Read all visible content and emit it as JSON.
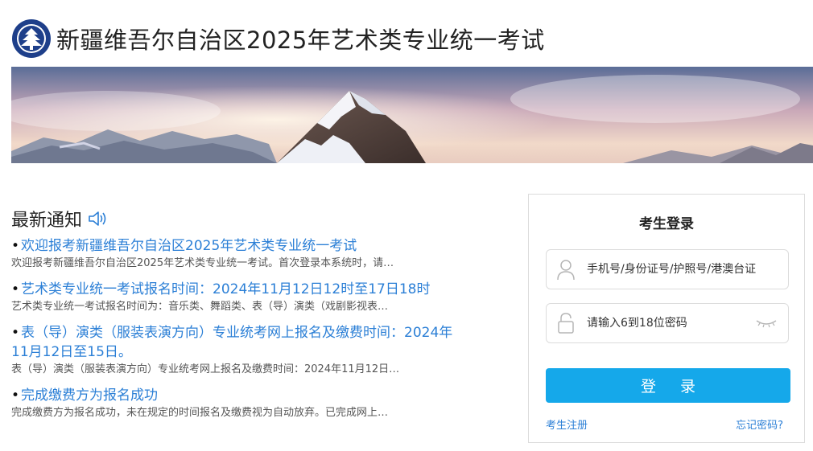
{
  "header": {
    "title": "新疆维吾尔自治区2025年艺术类专业统一考试"
  },
  "news": {
    "title": "最新通知",
    "items": [
      {
        "title": "欢迎报考新疆维吾尔自治区2025年艺术类专业统一考试",
        "summary": "欢迎报考新疆维吾尔自治区2025年艺术类专业统一考试。首次登录本系统时，请…"
      },
      {
        "title": "艺术类专业统一考试报名时间：2024年11月12日12时至17日18时",
        "summary": "艺术类专业统一考试报名时间为：音乐类、舞蹈类、表（导）演类（戏剧影视表…"
      },
      {
        "title": "表（导）演类（服装表演方向）专业统考网上报名及缴费时间：2024年11月12日至15日。",
        "summary": "表（导）演类（服装表演方向）专业统考网上报名及缴费时间：2024年11月12日…"
      },
      {
        "title": "完成缴费方为报名成功",
        "summary": "完成缴费方为报名成功，未在规定的时间报名及缴费视为自动放弃。已完成网上…"
      }
    ]
  },
  "login": {
    "title": "考生登录",
    "username_placeholder": "手机号/身份证号/护照号/港澳台证",
    "password_placeholder": "请输入6到18位密码",
    "submit_label": "登 录",
    "register_label": "考生注册",
    "forgot_label": "忘记密码?"
  },
  "colors": {
    "link": "#2b7fd6",
    "button": "#15a8ea"
  },
  "icons": {
    "logo": "emblem-logo",
    "speaker": "speaker-icon",
    "user": "user-icon",
    "lock": "lock-icon",
    "eye": "eye-closed-icon"
  }
}
